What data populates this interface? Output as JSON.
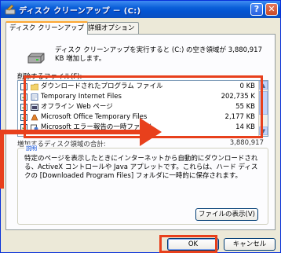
{
  "window": {
    "title": "ディスク クリーンアップ －  (C:)",
    "help_glyph": "?",
    "close_glyph": "✕"
  },
  "tabs": [
    {
      "label": "ディスク クリーンアップ"
    },
    {
      "label": "詳細オプション"
    }
  ],
  "intro_text": "ディスク クリーンアップを実行すると  (C:) の空き領域が 3,880,917 KB 増加します。",
  "files_label": "削除するファイル(F):",
  "files": [
    {
      "checked": false,
      "name": "ダウンロードされたプログラム ファイル",
      "size": "0 KB"
    },
    {
      "checked": true,
      "name": "Temporary Internet Files",
      "size": "202,735 K"
    },
    {
      "checked": true,
      "name": "オフライン Web ページ",
      "size": "55 KB"
    },
    {
      "checked": true,
      "name": "Microsoft Office Temporary Files",
      "size": "2,177 KB"
    },
    {
      "checked": true,
      "name": "Microsoft エラー報告の一時ファイル",
      "size": "14 KB"
    }
  ],
  "total": {
    "label": "増加するディスク領域の合計:",
    "value": "3,880,917"
  },
  "description": {
    "legend": "説明",
    "text": "特定のページを表示したときにインターネットから自動的にダウンロードされる、ActiveX コントロールや Java アプレットです。これらは、ハード ディスクの [Downloaded Program Files] フォルダに一時的に保存されます。",
    "view_files_label": "ファイルの表示(V)"
  },
  "buttons": {
    "ok": "OK",
    "cancel": "キャンセル"
  },
  "colors": {
    "annotation": "#e8401c",
    "titlebar": "#0a5fd8"
  }
}
